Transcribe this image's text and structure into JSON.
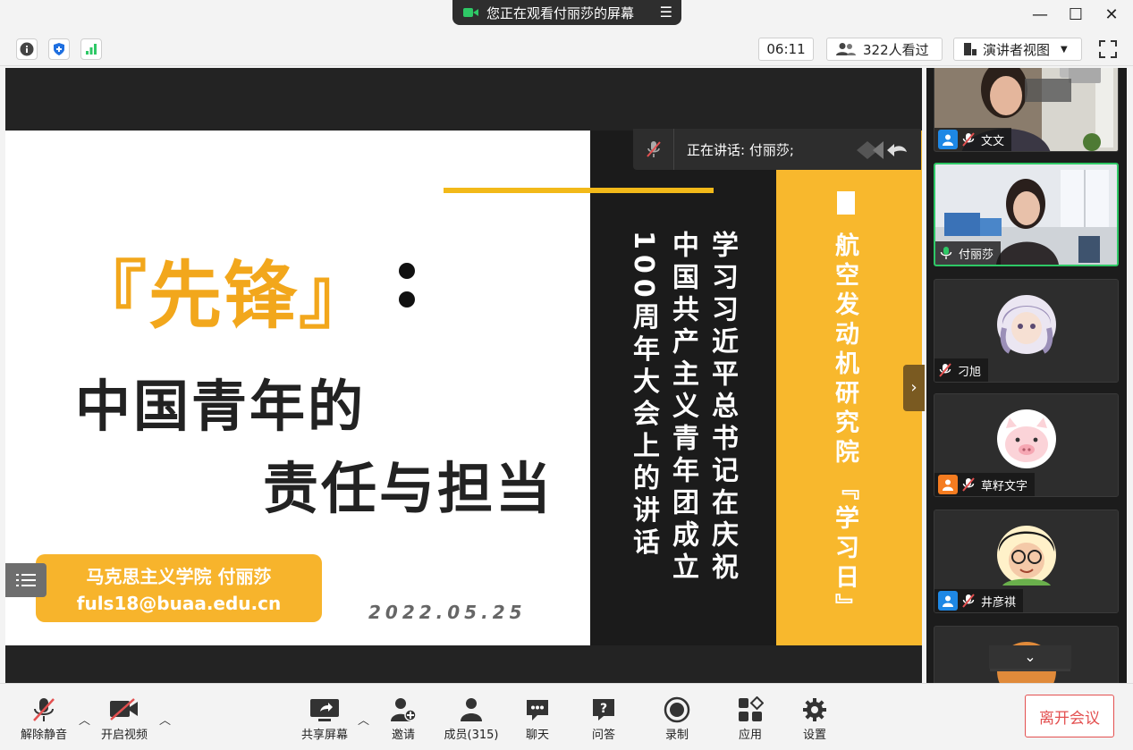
{
  "window": {
    "share_banner": "您正在观看付丽莎的屏幕",
    "controls": {
      "minimize": "—",
      "maximize": "☐",
      "close": "✕"
    }
  },
  "toolbar": {
    "time": "06:11",
    "viewers": "322人看过",
    "view_mode": "演讲者视图"
  },
  "speaking": {
    "label": "正在讲话: 付丽莎;"
  },
  "slide": {
    "title_highlight": "『先锋』",
    "title_line2": "中国青年的",
    "title_line3": "责任与担当",
    "author": "马克思主义学院  付丽莎",
    "email": "fuls18@buaa.edu.cn",
    "date": "2022.05.25",
    "vertical_title": "学习习近平总书记在庆祝中国共产主义青年团成立100周年大会上的讲话",
    "col1": "学习习近平总书记在庆祝",
    "col2": "中国共产主义青年团成立",
    "col3": "100周年大会上的讲话",
    "yellow_col_top": "航空发动机研究院",
    "yellow_col_bottom": "『学习日』"
  },
  "participants": [
    {
      "name": "文文",
      "muted": true,
      "user_icon_color": "#1e88e5"
    },
    {
      "name": "付丽莎",
      "muted": false,
      "active": true
    },
    {
      "name": "刁旭",
      "muted": true
    },
    {
      "name": "草籽文字",
      "muted": true,
      "user_icon_color": "#f57c20"
    },
    {
      "name": "井彦祺",
      "muted": true,
      "user_icon_color": "#1e88e5"
    }
  ],
  "bottom": {
    "unmute": "解除静音",
    "start_video": "开启视频",
    "share_screen": "共享屏幕",
    "invite": "邀请",
    "members": "成员(315)",
    "chat": "聊天",
    "qa": "问答",
    "record": "录制",
    "apps": "应用",
    "settings": "设置",
    "leave": "离开会议"
  },
  "colors": {
    "accent_green": "#2ec866",
    "slide_yellow": "#f8b82d",
    "title_orange": "#f2a71c",
    "leave_red": "#e35050"
  }
}
